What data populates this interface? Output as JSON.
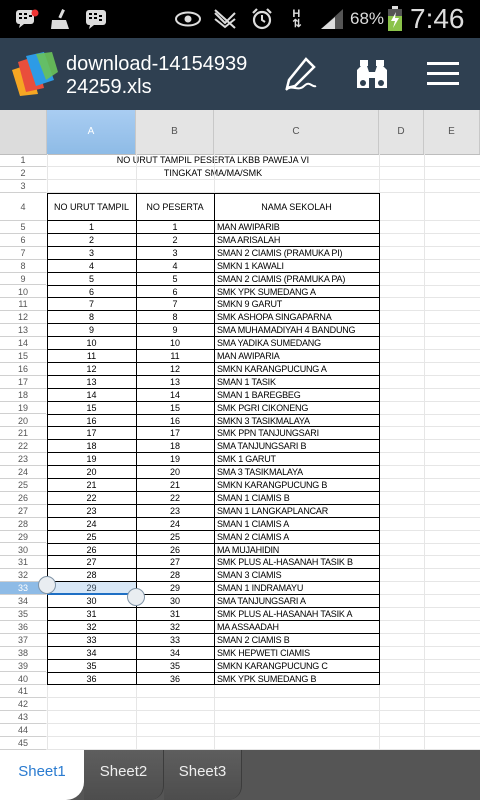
{
  "status_bar": {
    "battery_text": "68%",
    "clock": "7:46",
    "icons": [
      "bbm-icon",
      "cleaner-icon",
      "bbm-icon",
      "eye-icon",
      "no-signal-icon",
      "alarm-icon",
      "data-icon",
      "signal-icon",
      "battery-icon"
    ]
  },
  "app_bar": {
    "file_name": "download-1415493924259.xls",
    "icons": [
      "polaris-office-logo",
      "pen-icon",
      "binoculars-icon",
      "menu-icon"
    ]
  },
  "columns": [
    "A",
    "B",
    "C",
    "D",
    "E"
  ],
  "selected_column": "A",
  "selected_row": "33",
  "sheet": {
    "title1": "NO URUT TAMPIL PESERTA LKBB PAWEJA VI",
    "title2": "TINGKAT SMA/MA/SMK",
    "headers": {
      "no_urut": "NO URUT TAMPIL",
      "no_peserta": "NO PESERTA",
      "nama": "NAMA SEKOLAH"
    },
    "rows": [
      [
        "1",
        "1",
        "MAN AWIPARIB"
      ],
      [
        "2",
        "2",
        "SMA ARISALAH"
      ],
      [
        "3",
        "3",
        "SMAN 2 CIAMIS (PRAMUKA PI)"
      ],
      [
        "4",
        "4",
        "SMKN 1 KAWALI"
      ],
      [
        "5",
        "5",
        "SMAN 2 CIAMIS (PRAMUKA PA)"
      ],
      [
        "6",
        "6",
        "SMK YPK SUMEDANG A"
      ],
      [
        "7",
        "7",
        "SMKN 9 GARUT"
      ],
      [
        "8",
        "8",
        "SMK ASHOPA SINGAPARNA"
      ],
      [
        "9",
        "9",
        "SMA MUHAMADIYAH 4 BANDUNG"
      ],
      [
        "10",
        "10",
        "SMA YADIKA SUMEDANG"
      ],
      [
        "11",
        "11",
        "MAN AWIPARIA"
      ],
      [
        "12",
        "12",
        "SMKN KARANGPUCUNG A"
      ],
      [
        "13",
        "13",
        "SMAN 1 TASIK"
      ],
      [
        "14",
        "14",
        "SMAN 1 BAREGBEG"
      ],
      [
        "15",
        "15",
        "SMK PGRI CIKONENG"
      ],
      [
        "16",
        "16",
        "SMKN 3 TASIKMALAYA"
      ],
      [
        "17",
        "17",
        "SMK PPN TANJUNGSARI"
      ],
      [
        "18",
        "18",
        "SMA TANJUNGSARI B"
      ],
      [
        "19",
        "19",
        "SMK 1 GARUT"
      ],
      [
        "20",
        "20",
        "SMA 3 TASIKMALAYA"
      ],
      [
        "21",
        "21",
        "SMKN KARANGPUCUNG B"
      ],
      [
        "22",
        "22",
        "SMAN 1 CIAMIS B"
      ],
      [
        "23",
        "23",
        "SMAN 1 LANGKAPLANCAR"
      ],
      [
        "24",
        "24",
        "SMAN 1 CIAMIS A"
      ],
      [
        "25",
        "25",
        "SMAN 2 CIAMIS A"
      ],
      [
        "26",
        "26",
        "MA MUJAHIDIN"
      ],
      [
        "27",
        "27",
        "SMK PLUS AL-HASANAH TASIK B"
      ],
      [
        "28",
        "28",
        "SMAN 3 CIAMIS"
      ],
      [
        "29",
        "29",
        "SMAN 1 INDRAMAYU"
      ],
      [
        "30",
        "30",
        "SMA TANJUNGSARI A"
      ],
      [
        "31",
        "31",
        "SMK PLUS AL-HASANAH TASIK A"
      ],
      [
        "32",
        "32",
        "MA ASSAADAH"
      ],
      [
        "33",
        "33",
        "SMAN 2 CIAMIS B"
      ],
      [
        "34",
        "34",
        "SMK HEPWETI CIAMIS"
      ],
      [
        "35",
        "35",
        "SMKN KARANGPUCUNG C"
      ],
      [
        "36",
        "36",
        "SMK YPK SUMEDANG B"
      ]
    ]
  },
  "tabs": [
    "Sheet1",
    "Sheet2",
    "Sheet3"
  ],
  "active_tab": "Sheet1",
  "colors": {
    "app_bar": "#2f4051",
    "selection": "#8ebbe6",
    "active_tab_text": "#2a7bd0"
  }
}
